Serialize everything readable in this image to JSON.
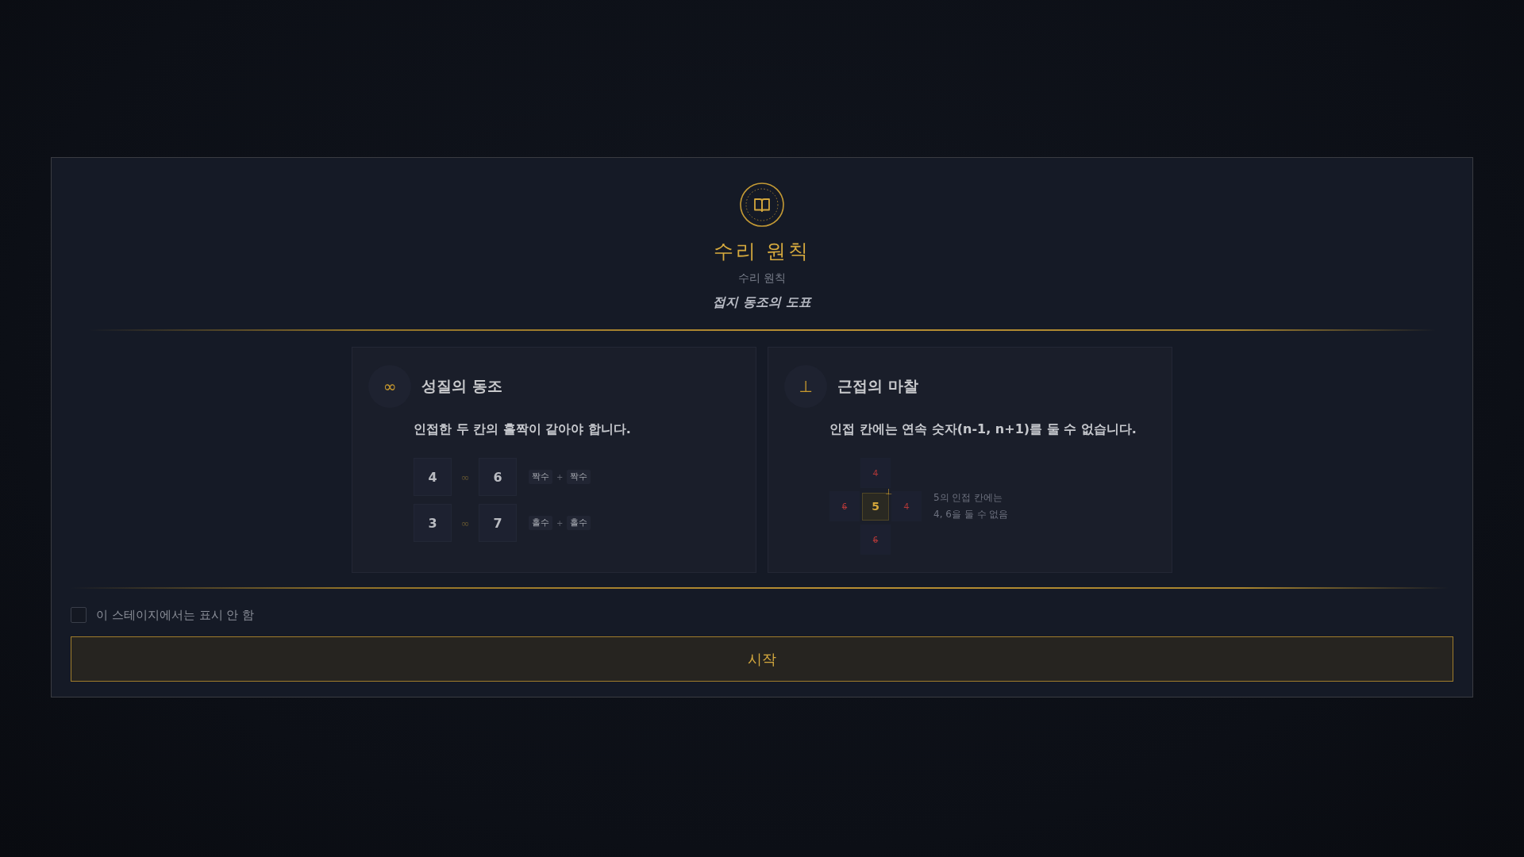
{
  "header": {
    "title": "수리 원칙",
    "subtitle": "수리 원칙",
    "caption": "접지 동조의 도표"
  },
  "cards": [
    {
      "kind": "parity",
      "icon": "∞",
      "title": "성질의 동조",
      "description": "인접한 두 칸의 홀짝이 같아야 합니다.",
      "examples": [
        {
          "a": "4",
          "link": "∞",
          "b": "6",
          "tag_a": "짝수",
          "plus": "+",
          "tag_b": "짝수"
        },
        {
          "a": "3",
          "link": "∞",
          "b": "7",
          "tag_a": "홀수",
          "plus": "+",
          "tag_b": "홀수"
        }
      ]
    },
    {
      "kind": "adjacency",
      "icon": "⊥",
      "title": "근접의 마찰",
      "description": "인접 칸에는 연속 숫자(n-1, n+1)를 둘 수 없습니다.",
      "diagram": {
        "center": "5",
        "center_mark": "⊥",
        "neighbors": [
          {
            "value": "4",
            "blocked": true
          },
          {
            "value": "6",
            "blocked": true
          },
          {
            "value": "4",
            "blocked": true
          },
          {
            "value": "6",
            "blocked": true
          }
        ],
        "note": "5의 인접 칸에는\n4, 6을 둘 수 없음"
      }
    }
  ],
  "checkbox": {
    "label": "이 스테이지에서는 표시 안 함",
    "checked": false
  },
  "start_button": "시작"
}
